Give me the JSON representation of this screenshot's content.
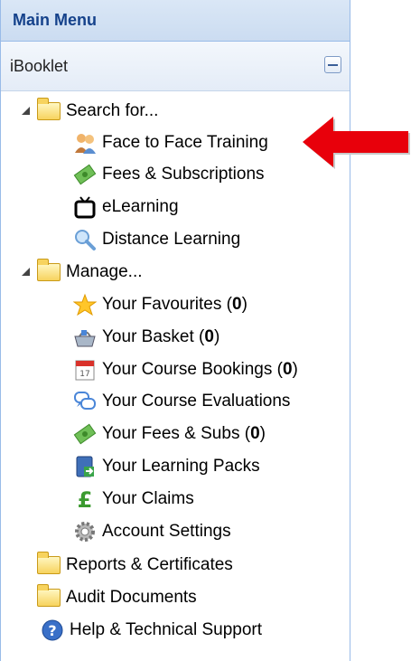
{
  "panel": {
    "title": "Main Menu",
    "subtitle": "iBooklet"
  },
  "tree": {
    "search_group": {
      "label": "Search for...",
      "items": [
        {
          "label": "Face to Face Training",
          "icon": "people-icon"
        },
        {
          "label": "Fees & Subscriptions",
          "icon": "money-icon"
        },
        {
          "label": "eLearning",
          "icon": "tv-icon"
        },
        {
          "label": "Distance Learning",
          "icon": "magnifier-icon"
        }
      ]
    },
    "manage_group": {
      "label": "Manage...",
      "items": [
        {
          "label": "Your Favourites (",
          "count": "0",
          "suffix": ")",
          "icon": "star-icon"
        },
        {
          "label": "Your Basket (",
          "count": "0",
          "suffix": ")",
          "icon": "basket-icon"
        },
        {
          "label": "Your Course Bookings (",
          "count": "0",
          "suffix": ")",
          "icon": "calendar-icon"
        },
        {
          "label": "Your Course Evaluations",
          "icon": "speech-bubbles-icon"
        },
        {
          "label": "Your Fees & Subs (",
          "count": "0",
          "suffix": ")",
          "icon": "money-icon"
        },
        {
          "label": "Your Learning Packs",
          "icon": "book-icon"
        },
        {
          "label": "Your Claims",
          "icon": "pound-icon"
        },
        {
          "label": "Account Settings",
          "icon": "gear-icon"
        }
      ]
    },
    "reports_label": "Reports & Certificates",
    "audit_label": "Audit Documents",
    "help_label": "Help & Technical Support"
  },
  "colors": {
    "header_text": "#15428b",
    "arrow": "#e8000b"
  }
}
